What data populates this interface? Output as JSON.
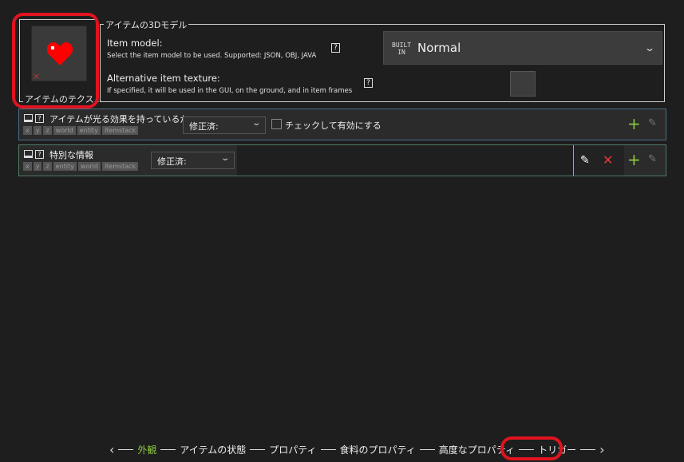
{
  "texture": {
    "label": "アイテムのテクス...",
    "remove_mark": "×",
    "icon": "heart-icon",
    "icon_color": "#ff0000"
  },
  "model_group": {
    "legend": "アイテムの3Dモデル",
    "item_model": {
      "title": "Item model:",
      "description": "Select the item model to be used. Supported: JSON, OBJ, JAVA",
      "help": "?",
      "builtin_badge_line1": "BUILT",
      "builtin_badge_line2": "IN",
      "value": "Normal"
    },
    "alt_texture": {
      "title": "Alternative item texture:",
      "description": "If specified, it will be used in the GUI, on the ground, and in item frames",
      "help": "?"
    }
  },
  "rows": [
    {
      "label": "アイテムが光る効果を持っているか",
      "help": "?",
      "tags": [
        "x",
        "y",
        "z",
        "world",
        "entity",
        "itemstack"
      ],
      "mode": "修正済:",
      "checkbox_label": "チェックして有効にする",
      "checked": false
    },
    {
      "label": "特別な情報",
      "help": "?",
      "tags": [
        "x",
        "y",
        "z",
        "entity",
        "world",
        "itemstack"
      ],
      "mode": "修正済:"
    }
  ],
  "tabs": {
    "prev": "‹",
    "next": "›",
    "items": [
      "外観",
      "アイテムの状態",
      "プロパティ",
      "食料のプロパティ",
      "高度なプロパティ",
      "トリガー"
    ],
    "active_index": 0,
    "active_color": "#8cc63f"
  },
  "icons": {
    "add": "+",
    "edit": "✎",
    "remove": "✕"
  },
  "highlight_color": "#e0131f"
}
